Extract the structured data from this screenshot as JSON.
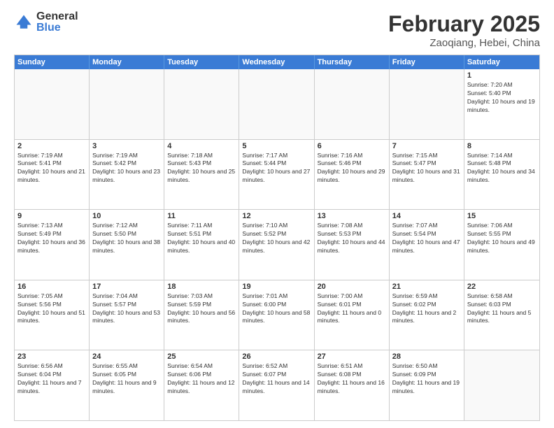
{
  "logo": {
    "general": "General",
    "blue": "Blue"
  },
  "title": {
    "month": "February 2025",
    "location": "Zaoqiang, Hebei, China"
  },
  "days_of_week": [
    "Sunday",
    "Monday",
    "Tuesday",
    "Wednesday",
    "Thursday",
    "Friday",
    "Saturday"
  ],
  "weeks": [
    [
      {
        "day": null,
        "info": null
      },
      {
        "day": null,
        "info": null
      },
      {
        "day": null,
        "info": null
      },
      {
        "day": null,
        "info": null
      },
      {
        "day": null,
        "info": null
      },
      {
        "day": null,
        "info": null
      },
      {
        "day": "1",
        "info": "Sunrise: 7:20 AM\nSunset: 5:40 PM\nDaylight: 10 hours and 19 minutes."
      }
    ],
    [
      {
        "day": "2",
        "info": "Sunrise: 7:19 AM\nSunset: 5:41 PM\nDaylight: 10 hours and 21 minutes."
      },
      {
        "day": "3",
        "info": "Sunrise: 7:19 AM\nSunset: 5:42 PM\nDaylight: 10 hours and 23 minutes."
      },
      {
        "day": "4",
        "info": "Sunrise: 7:18 AM\nSunset: 5:43 PM\nDaylight: 10 hours and 25 minutes."
      },
      {
        "day": "5",
        "info": "Sunrise: 7:17 AM\nSunset: 5:44 PM\nDaylight: 10 hours and 27 minutes."
      },
      {
        "day": "6",
        "info": "Sunrise: 7:16 AM\nSunset: 5:46 PM\nDaylight: 10 hours and 29 minutes."
      },
      {
        "day": "7",
        "info": "Sunrise: 7:15 AM\nSunset: 5:47 PM\nDaylight: 10 hours and 31 minutes."
      },
      {
        "day": "8",
        "info": "Sunrise: 7:14 AM\nSunset: 5:48 PM\nDaylight: 10 hours and 34 minutes."
      }
    ],
    [
      {
        "day": "9",
        "info": "Sunrise: 7:13 AM\nSunset: 5:49 PM\nDaylight: 10 hours and 36 minutes."
      },
      {
        "day": "10",
        "info": "Sunrise: 7:12 AM\nSunset: 5:50 PM\nDaylight: 10 hours and 38 minutes."
      },
      {
        "day": "11",
        "info": "Sunrise: 7:11 AM\nSunset: 5:51 PM\nDaylight: 10 hours and 40 minutes."
      },
      {
        "day": "12",
        "info": "Sunrise: 7:10 AM\nSunset: 5:52 PM\nDaylight: 10 hours and 42 minutes."
      },
      {
        "day": "13",
        "info": "Sunrise: 7:08 AM\nSunset: 5:53 PM\nDaylight: 10 hours and 44 minutes."
      },
      {
        "day": "14",
        "info": "Sunrise: 7:07 AM\nSunset: 5:54 PM\nDaylight: 10 hours and 47 minutes."
      },
      {
        "day": "15",
        "info": "Sunrise: 7:06 AM\nSunset: 5:55 PM\nDaylight: 10 hours and 49 minutes."
      }
    ],
    [
      {
        "day": "16",
        "info": "Sunrise: 7:05 AM\nSunset: 5:56 PM\nDaylight: 10 hours and 51 minutes."
      },
      {
        "day": "17",
        "info": "Sunrise: 7:04 AM\nSunset: 5:57 PM\nDaylight: 10 hours and 53 minutes."
      },
      {
        "day": "18",
        "info": "Sunrise: 7:03 AM\nSunset: 5:59 PM\nDaylight: 10 hours and 56 minutes."
      },
      {
        "day": "19",
        "info": "Sunrise: 7:01 AM\nSunset: 6:00 PM\nDaylight: 10 hours and 58 minutes."
      },
      {
        "day": "20",
        "info": "Sunrise: 7:00 AM\nSunset: 6:01 PM\nDaylight: 11 hours and 0 minutes."
      },
      {
        "day": "21",
        "info": "Sunrise: 6:59 AM\nSunset: 6:02 PM\nDaylight: 11 hours and 2 minutes."
      },
      {
        "day": "22",
        "info": "Sunrise: 6:58 AM\nSunset: 6:03 PM\nDaylight: 11 hours and 5 minutes."
      }
    ],
    [
      {
        "day": "23",
        "info": "Sunrise: 6:56 AM\nSunset: 6:04 PM\nDaylight: 11 hours and 7 minutes."
      },
      {
        "day": "24",
        "info": "Sunrise: 6:55 AM\nSunset: 6:05 PM\nDaylight: 11 hours and 9 minutes."
      },
      {
        "day": "25",
        "info": "Sunrise: 6:54 AM\nSunset: 6:06 PM\nDaylight: 11 hours and 12 minutes."
      },
      {
        "day": "26",
        "info": "Sunrise: 6:52 AM\nSunset: 6:07 PM\nDaylight: 11 hours and 14 minutes."
      },
      {
        "day": "27",
        "info": "Sunrise: 6:51 AM\nSunset: 6:08 PM\nDaylight: 11 hours and 16 minutes."
      },
      {
        "day": "28",
        "info": "Sunrise: 6:50 AM\nSunset: 6:09 PM\nDaylight: 11 hours and 19 minutes."
      },
      {
        "day": null,
        "info": null
      }
    ]
  ]
}
